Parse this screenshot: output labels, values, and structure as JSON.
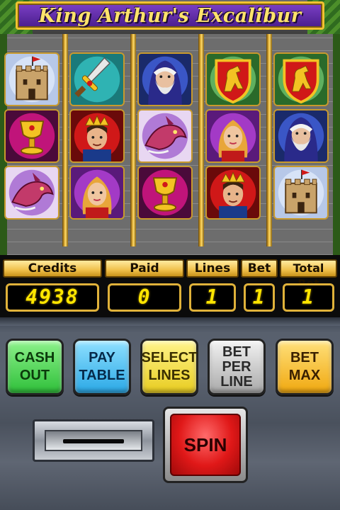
{
  "title": "King Arthur's Excalibur",
  "reels": [
    [
      "castle",
      "chalice",
      "dragon"
    ],
    [
      "sword",
      "king",
      "queen"
    ],
    [
      "wizard",
      "dragon",
      "chalice"
    ],
    [
      "lion-shield",
      "queen",
      "king"
    ],
    [
      "lion-shield",
      "wizard",
      "castle"
    ]
  ],
  "stats": {
    "credits_label": "Credits",
    "credits_value": "4938",
    "paid_label": "Paid",
    "paid_value": "0",
    "lines_label": "Lines",
    "lines_value": "1",
    "bet_label": "Bet",
    "bet_value": "1",
    "total_bet_label": "Total Bet",
    "total_bet_value": "1"
  },
  "buttons": {
    "cash_out": "CASH\nOUT",
    "pay_table": "PAY\nTABLE",
    "select_lines": "SELECT\nLINES",
    "bet_per_line": "BET\nPER\nLINE",
    "bet_max": "BET\nMAX",
    "spin": "SPIN"
  },
  "colors": {
    "title_plate": "#5a2aa8",
    "title_text": "#ffe36b",
    "digit": "#ffe600",
    "frame_gold": "#e0b23a",
    "spin_red": "#e01818"
  }
}
